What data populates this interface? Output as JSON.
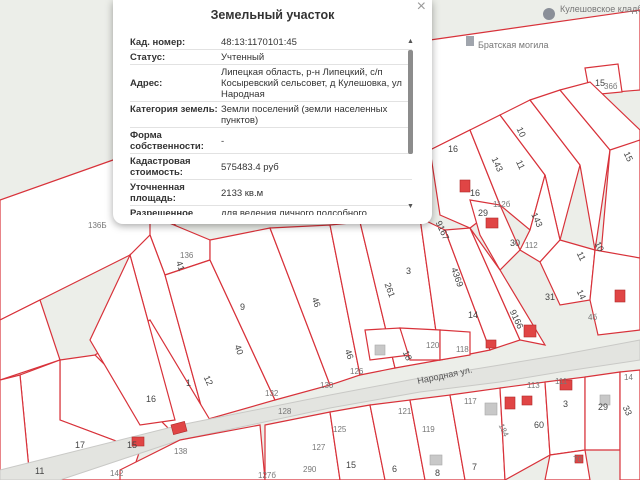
{
  "popup": {
    "title": "Земельный участок",
    "close": "×",
    "rows": [
      {
        "key": "Кад. номер:",
        "value": "48:13:1170101:45"
      },
      {
        "key": "Статус:",
        "value": "Учтенный"
      },
      {
        "key": "Адрес:",
        "value": "Липецкая область, р-н Липецкий, с/п Косыревский сельсовет, д Кулешовка, ул Народная"
      },
      {
        "key": "Категория земель:",
        "value": "Земли поселений (земли населенных пунктов)"
      },
      {
        "key": "Форма собственности:",
        "value": "-"
      },
      {
        "key": "Кадастровая стоимость:",
        "value": "575483.4 руб"
      },
      {
        "key": "Уточненная площадь:",
        "value": "2133 кв.м"
      },
      {
        "key": "Разрешенное",
        "value": "для ведения личного подсобного"
      }
    ],
    "scroll_up": "▲",
    "scroll_down": "▼"
  },
  "map": {
    "poi_cemetery": "Кулешовское кладбище",
    "poi_grave": "Братская могила",
    "street_name": "Народная ул.",
    "labels": {
      "l136b": "136Б",
      "l136": "136",
      "l41": "41",
      "l9": "9",
      "l40": "40",
      "l46": "46",
      "l46b": "46",
      "l261": "261",
      "l3": "3",
      "l4369": "4369",
      "l14": "14",
      "l9166": "9166",
      "l9167": "9167",
      "l16a": "16",
      "l16b": "16",
      "l143": "143",
      "l11": "11",
      "l10": "10",
      "l1126": "112б",
      "l143b": "143",
      "l29": "29",
      "l30": "30",
      "l112": "112",
      "l31": "31",
      "l11b": "11",
      "l14b": "14",
      "l10b": "10",
      "l15": "15",
      "l15b": "15",
      "l136a": "136а",
      "l15c": "15",
      "l16c": "16",
      "l1": "1",
      "l12": "12",
      "l17": "17",
      "l138": "138",
      "l132": "132",
      "l130": "130",
      "l126": "126",
      "l128": "128",
      "l18": "18",
      "l120": "120",
      "l118": "118",
      "l121": "121",
      "l119": "119",
      "l117": "117",
      "l113": "113",
      "l111": "111",
      "l3b": "3",
      "l60": "60",
      "l70": "70",
      "l184": "184",
      "l8": "8",
      "l7": "7",
      "l6": "6",
      "l290": "290",
      "l127b": "127б",
      "l127": "127",
      "l125": "125",
      "l142": "142",
      "l11c": "11",
      "l29b": "29",
      "l33": "33",
      "l14c": "14",
      "l36b": "36б",
      "l46c": "4б",
      "l15d": "15"
    }
  }
}
